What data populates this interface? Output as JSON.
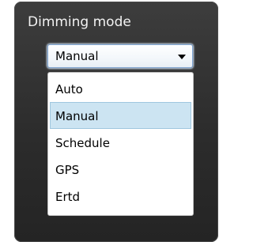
{
  "dimming": {
    "title": "Dimming mode",
    "selected_value": "Manual",
    "selected_index": 1,
    "options": [
      "Auto",
      "Manual",
      "Schedule",
      "GPS",
      "Ertd"
    ],
    "dropdown_icon": "triangle-down-icon"
  },
  "colors": {
    "panel_background": "#2c2c2c",
    "title_text": "#f2f2f2",
    "focus_border": "#7da2ce",
    "selected_option_background": "#cce4f2"
  }
}
